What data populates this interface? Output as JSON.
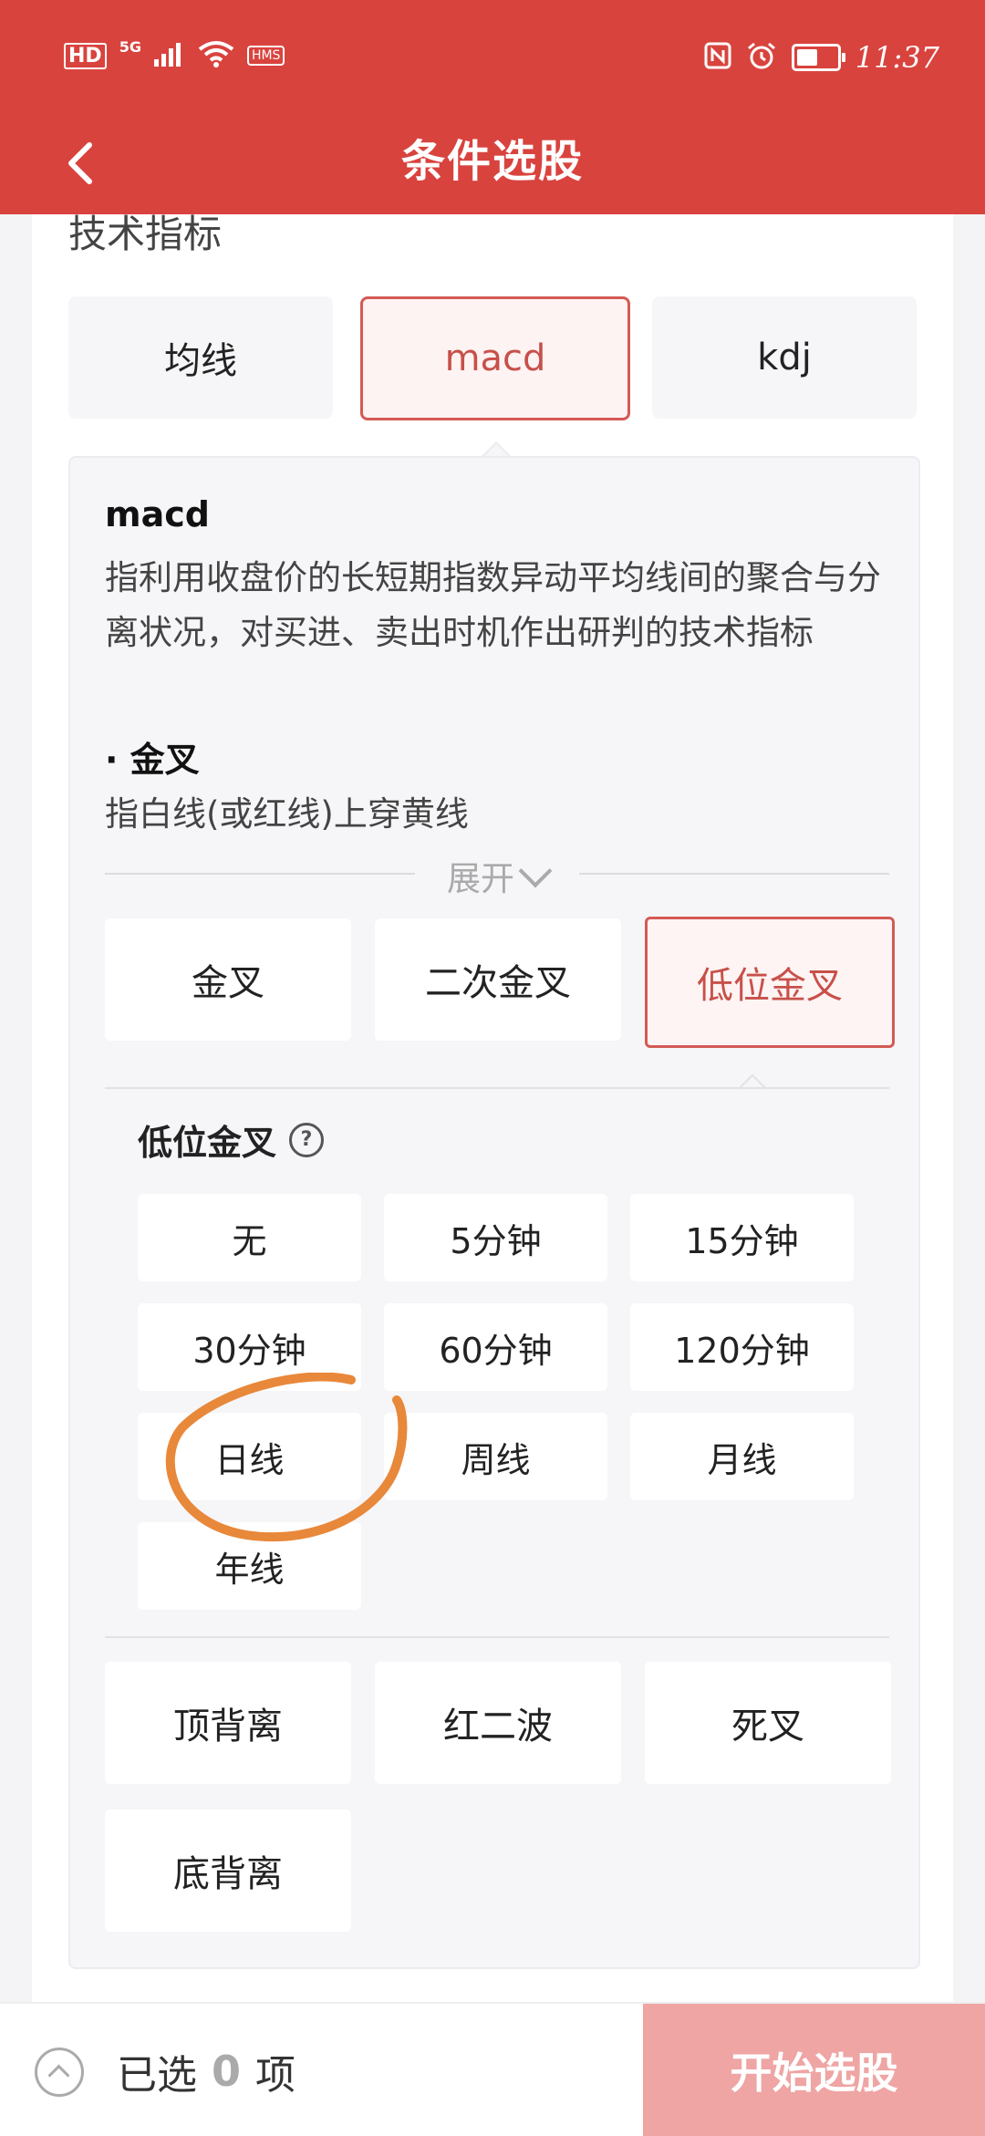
{
  "status_bar": {
    "left_icons": [
      "HD",
      "5G",
      "signal-icon",
      "wifi-icon",
      "HMS"
    ],
    "hd_label": "HD",
    "net_label": "5G",
    "hms_label": "HMS",
    "right_icons": [
      "nfc-icon",
      "alarm-icon",
      "battery-icon"
    ],
    "time": "11:37"
  },
  "header": {
    "title": "条件选股",
    "back_icon": "chevron-left-icon",
    "bg_color": "#d9433e"
  },
  "section": {
    "title": "技术指标",
    "tabs": [
      {
        "label": "均线",
        "active": false
      },
      {
        "label": "macd",
        "active": true
      },
      {
        "label": "kdj",
        "active": false
      }
    ]
  },
  "description": {
    "title": "macd",
    "body": "指利用收盘价的长短期指数异动平均线间的聚合与分离状况，对买进、卖出时机作出研判的技术指标",
    "sub_title": "· 金叉",
    "sub_body": "指白线(或红线)上穿黄线",
    "expand_label": "展开"
  },
  "options_row1": [
    {
      "label": "金叉",
      "active": false
    },
    {
      "label": "二次金叉",
      "active": false
    },
    {
      "label": "低位金叉",
      "active": true
    }
  ],
  "low_cross": {
    "title": "低位金叉",
    "help_icon": "question-circle-icon",
    "frequencies": [
      "无",
      "5分钟",
      "15分钟",
      "30分钟",
      "60分钟",
      "120分钟",
      "日线",
      "周线",
      "月线",
      "年线"
    ]
  },
  "options_row2": [
    "顶背离",
    "红二波",
    "死叉"
  ],
  "options_row3": [
    "底背离"
  ],
  "bottom_bar": {
    "selected_prefix": "已选",
    "selected_count": "0",
    "selected_suffix": "项",
    "start_label": "开始选股",
    "start_color": "#eea5a4"
  },
  "annotation": {
    "type": "hand-drawn-circle",
    "color": "#e8883a",
    "target": "日线"
  }
}
